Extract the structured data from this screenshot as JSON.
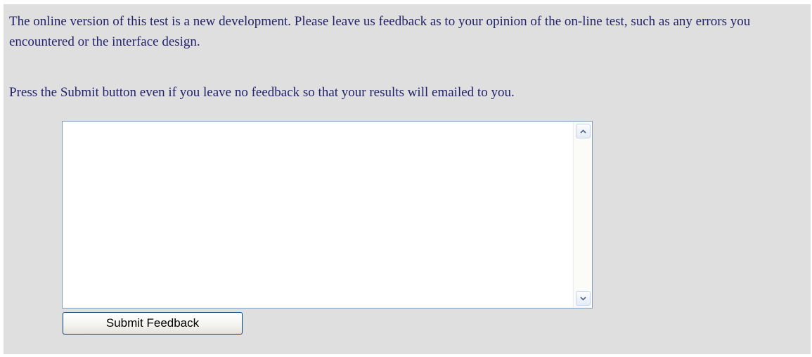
{
  "form": {
    "intro_text": "The online version of this test is a new development. Please leave us feedback as to your opinion of the on-line test, such as any errors you encountered or the interface design.",
    "instruction_text": "Press the Submit button even if you leave no feedback so that your results will emailed to you.",
    "feedback_value": "",
    "submit_label": "Submit Feedback"
  },
  "icons": {
    "scroll_up": "chevron-up-icon",
    "scroll_down": "chevron-down-icon"
  },
  "colors": {
    "background": "#dfdfdf",
    "text": "#22226a",
    "textarea_border": "#7f9db9",
    "button_border": "#003c74"
  }
}
